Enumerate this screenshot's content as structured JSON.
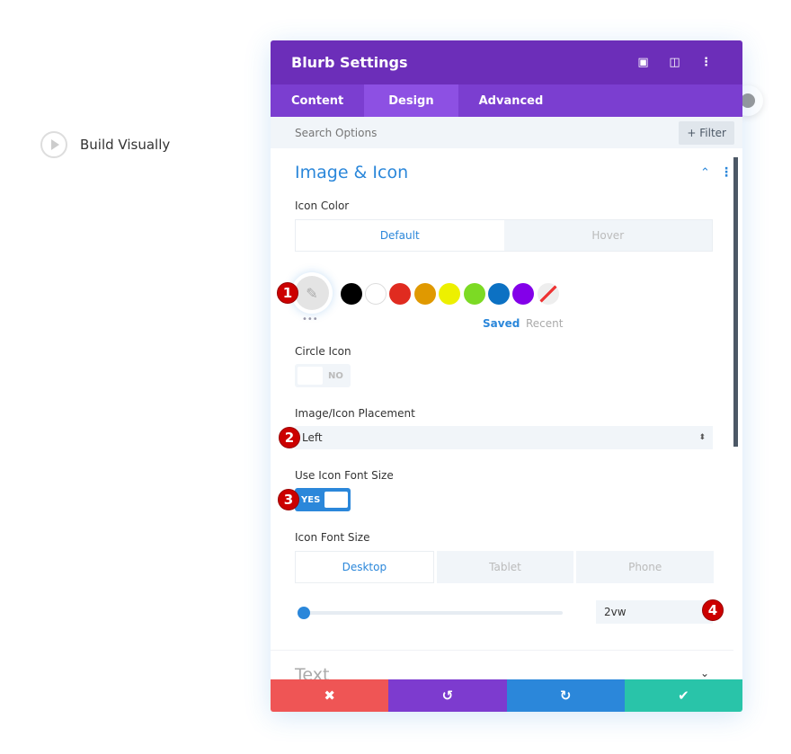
{
  "page": {
    "build_visually": "Build Visually"
  },
  "panel": {
    "title": "Blurb Settings",
    "header_icons": [
      "fullscreen-icon",
      "columns-icon",
      "more-vertical-icon"
    ],
    "tabs": [
      {
        "label": "Content"
      },
      {
        "label": "Design",
        "active": true
      },
      {
        "label": "Advanced"
      }
    ],
    "search_placeholder": "Search Options",
    "filter_label": "+ Filter",
    "section": {
      "title": "Image & Icon",
      "collapsed_title": "Text"
    },
    "icon_color": {
      "label": "Icon Color",
      "tabs": [
        "Default",
        "Hover"
      ],
      "active": "Default",
      "swatches": [
        "#000000",
        "#ffffff",
        "#e02b20",
        "#e09900",
        "#edf000",
        "#7cda24",
        "#0c71c3",
        "#8300e9"
      ],
      "palette_tabs": [
        "Saved",
        "Recent"
      ],
      "more": "•••"
    },
    "circle_icon": {
      "label": "Circle Icon",
      "value": "NO"
    },
    "placement": {
      "label": "Image/Icon Placement",
      "value": "Left"
    },
    "use_font_size": {
      "label": "Use Icon Font Size",
      "value": "YES"
    },
    "font_size": {
      "label": "Icon Font Size",
      "tabs": [
        "Desktop",
        "Tablet",
        "Phone"
      ],
      "active": "Desktop",
      "value": "2vw",
      "slider_percent": 0
    },
    "badges": [
      "1",
      "2",
      "3",
      "4"
    ],
    "footer": {
      "colors": [
        "#ef5555",
        "#7d3bcf",
        "#2b87da",
        "#29c4a9"
      ]
    }
  }
}
